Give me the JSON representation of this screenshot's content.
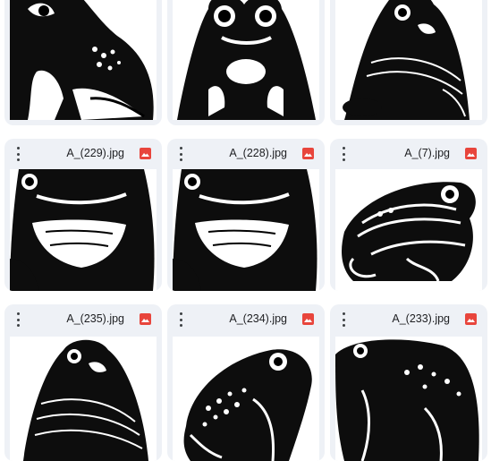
{
  "files": [
    {
      "name": "",
      "type_icon": "image-icon",
      "accent": "#e8453c"
    },
    {
      "name": "",
      "type_icon": "image-icon",
      "accent": "#e8453c"
    },
    {
      "name": "",
      "type_icon": "image-icon",
      "accent": "#e8453c"
    },
    {
      "name": "A_(229).jpg",
      "type_icon": "image-icon",
      "accent": "#e8453c"
    },
    {
      "name": "A_(228).jpg",
      "type_icon": "image-icon",
      "accent": "#e8453c"
    },
    {
      "name": "A_(7).jpg",
      "type_icon": "image-icon",
      "accent": "#e8453c"
    },
    {
      "name": "A_(235).jpg",
      "type_icon": "image-icon",
      "accent": "#e8453c"
    },
    {
      "name": "A_(234).jpg",
      "type_icon": "image-icon",
      "accent": "#e8453c"
    },
    {
      "name": "A_(233).jpg",
      "type_icon": "image-icon",
      "accent": "#e8453c"
    }
  ]
}
